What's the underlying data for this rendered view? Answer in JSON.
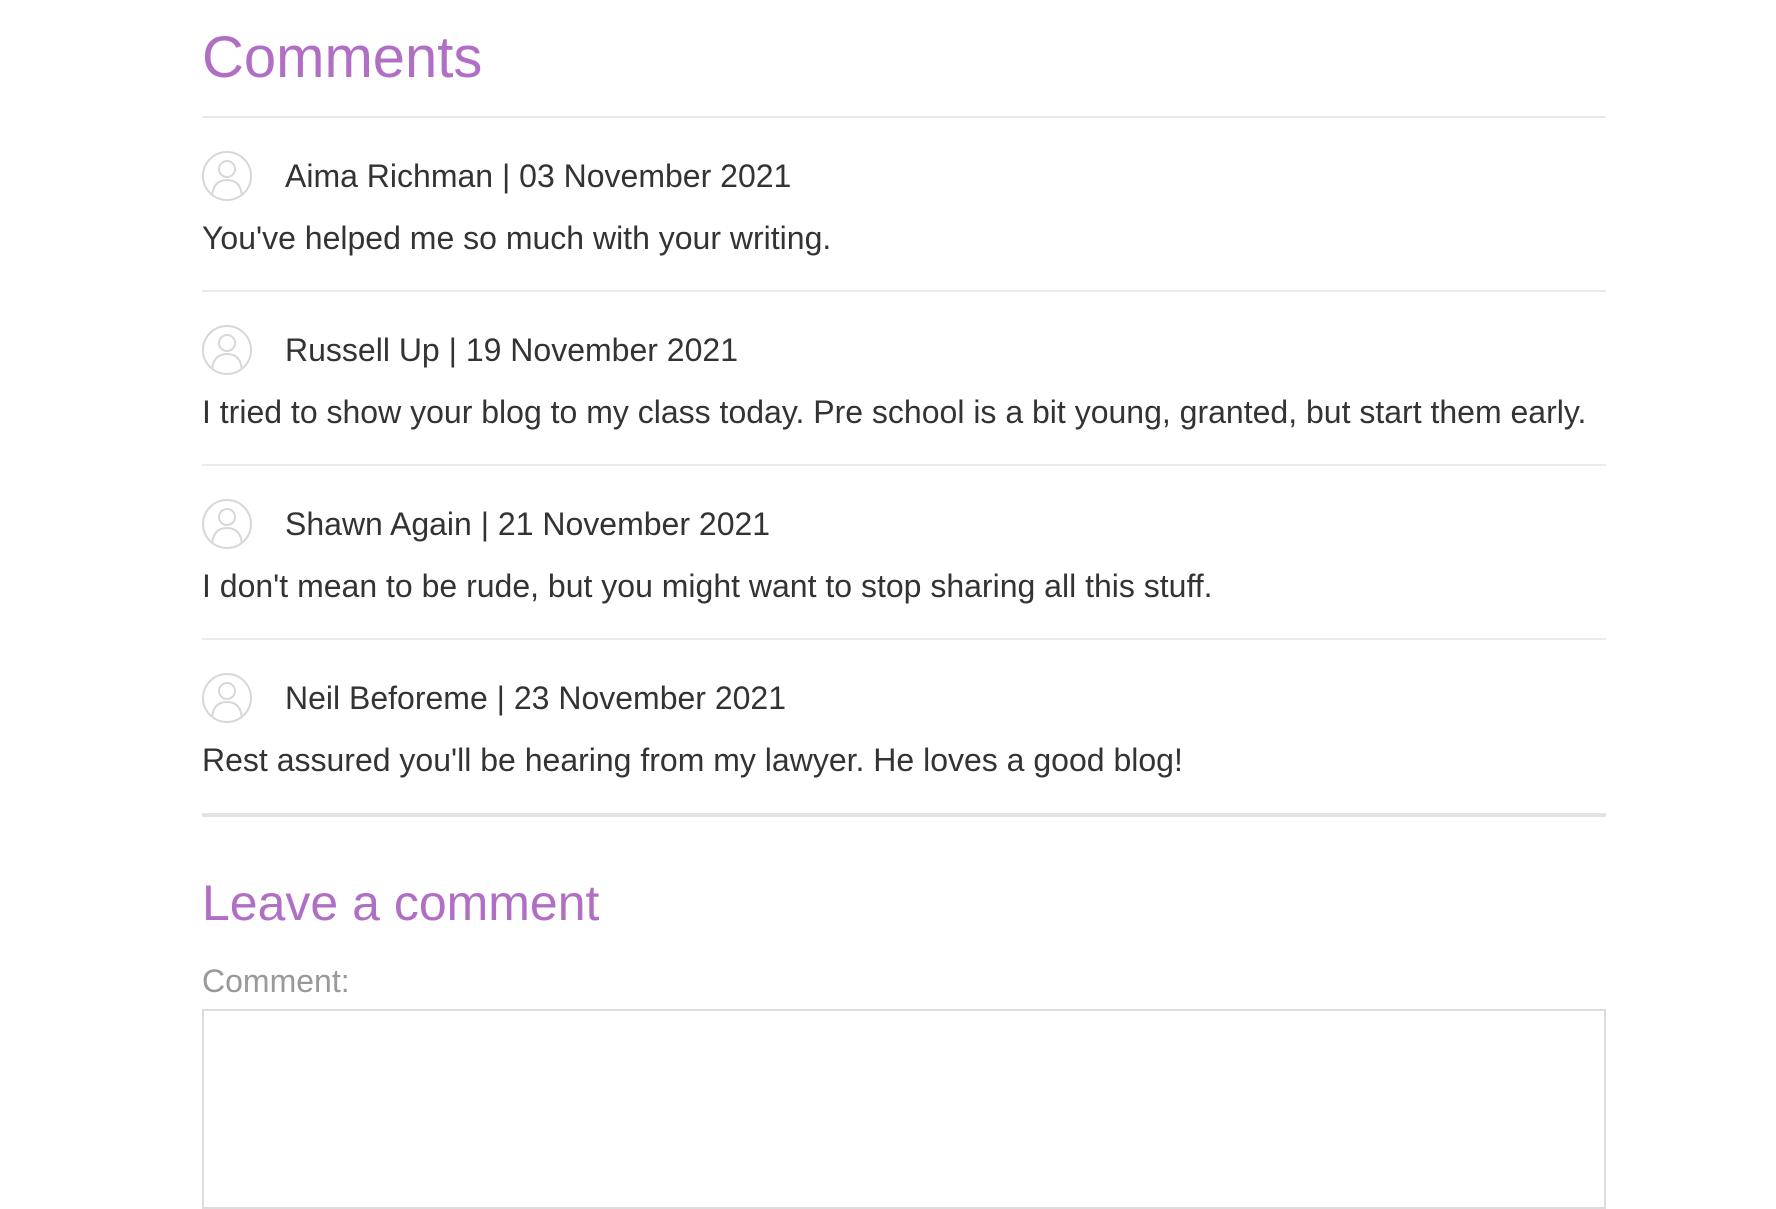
{
  "comments_section": {
    "title": "Comments",
    "items": [
      {
        "author": "Aima Richman",
        "date": "03 November 2021",
        "meta": "Aima Richman | 03 November 2021",
        "text": "You've helped me so much with your writing."
      },
      {
        "author": "Russell Up",
        "date": "19 November 2021",
        "meta": "Russell Up | 19 November 2021",
        "text": "I tried to show your blog to my class today. Pre school is a bit young, granted, but start them early."
      },
      {
        "author": "Shawn Again",
        "date": "21 November 2021",
        "meta": "Shawn Again | 21 November 2021",
        "text": "I don't mean to be rude, but you might want to stop sharing all this stuff."
      },
      {
        "author": "Neil Beforeme",
        "date": "23 November 2021",
        "meta": "Neil Beforeme | 23 November 2021",
        "text": "Rest assured you'll be hearing from my lawyer. He loves a good blog!"
      }
    ]
  },
  "comment_form": {
    "title": "Leave a comment",
    "label": "Comment:",
    "value": ""
  },
  "colors": {
    "heading": "#b06fc4",
    "text": "#333333",
    "label": "#999999",
    "divider": "#ebebeb"
  },
  "icons": {
    "avatar": "user-avatar-icon"
  }
}
